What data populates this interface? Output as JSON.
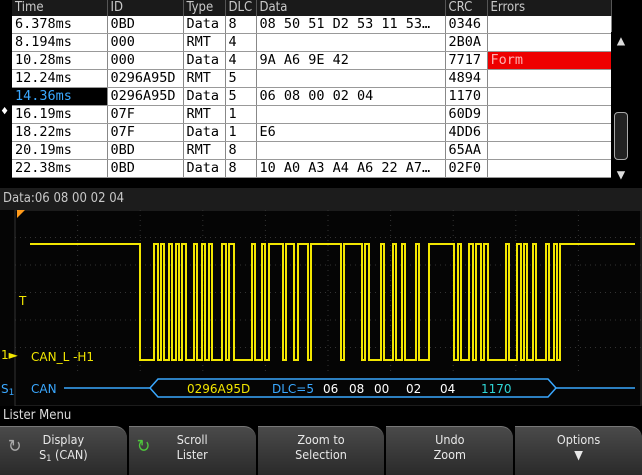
{
  "table": {
    "headers": [
      "Time",
      "ID",
      "Type",
      "DLC",
      "Data",
      "CRC",
      "Errors"
    ],
    "rows": [
      {
        "time": "6.378ms",
        "id": "0BD",
        "type": "Data",
        "dlc": "8",
        "data": "08 50 51 D2 53 11 53…",
        "crc": "0346",
        "errors": ""
      },
      {
        "time": "8.194ms",
        "id": "000",
        "type": "RMT",
        "dlc": "4",
        "data": "",
        "crc": "2B0A",
        "errors": ""
      },
      {
        "time": "10.28ms",
        "id": "000",
        "type": "Data",
        "dlc": "4",
        "data": "9A A6 9E 42",
        "crc": "7717",
        "errors": "Form"
      },
      {
        "time": "12.24ms",
        "id": "0296A95D",
        "type": "RMT",
        "dlc": "5",
        "data": "",
        "crc": "4894",
        "errors": ""
      },
      {
        "time": "14.36ms",
        "id": "0296A95D",
        "type": "Data",
        "dlc": "5",
        "data": "06 08 00 02 04",
        "crc": "1170",
        "errors": ""
      },
      {
        "time": "16.19ms",
        "id": "07F",
        "type": "RMT",
        "dlc": "1",
        "data": "",
        "crc": "60D9",
        "errors": ""
      },
      {
        "time": "18.22ms",
        "id": "07F",
        "type": "Data",
        "dlc": "1",
        "data": "E6",
        "crc": "4DD6",
        "errors": ""
      },
      {
        "time": "20.19ms",
        "id": "0BD",
        "type": "RMT",
        "dlc": "8",
        "data": "",
        "crc": "65AA",
        "errors": ""
      },
      {
        "time": "22.38ms",
        "id": "0BD",
        "type": "Data",
        "dlc": "8",
        "data": "10 A0 A3 A4 A6 22 A7…",
        "crc": "02F0",
        "errors": ""
      }
    ],
    "selected_marker": "♦"
  },
  "data_line": "Data:06 08 00 02 04",
  "waveform": {
    "trigger_marker": "T",
    "ch1_label_prefix": "1",
    "ch1_name": "CAN_L -H1",
    "bus_label_prefix": "S",
    "bus_label_sub": "1",
    "bus_name": "CAN",
    "decode": {
      "id": "0296A95D",
      "dlc": "DLC=5",
      "bytes": [
        "06",
        "08",
        "00",
        "02",
        "04"
      ],
      "crc": "1170"
    },
    "colors": {
      "signal": "#f2e600",
      "bus": "#3aa8ff",
      "decode_text_id": "#f2e600",
      "decode_text_dlc": "#3aa8ff",
      "decode_text_crc": "#2fd6d6"
    }
  },
  "menu": {
    "title": "Lister Menu",
    "softkeys": [
      {
        "line1": "Display",
        "line2": "S",
        "line2_sub": "1",
        "line2_rest": " (CAN)",
        "icon": "cycle-icon-dim"
      },
      {
        "line1": "Scroll",
        "line2": "Lister",
        "icon": "cycle-icon-green"
      },
      {
        "line1": "Zoom to",
        "line2": "Selection",
        "icon": ""
      },
      {
        "line1": "Undo",
        "line2": "Zoom",
        "icon": ""
      },
      {
        "line1": "Options",
        "line2": "▼",
        "icon": ""
      }
    ]
  }
}
